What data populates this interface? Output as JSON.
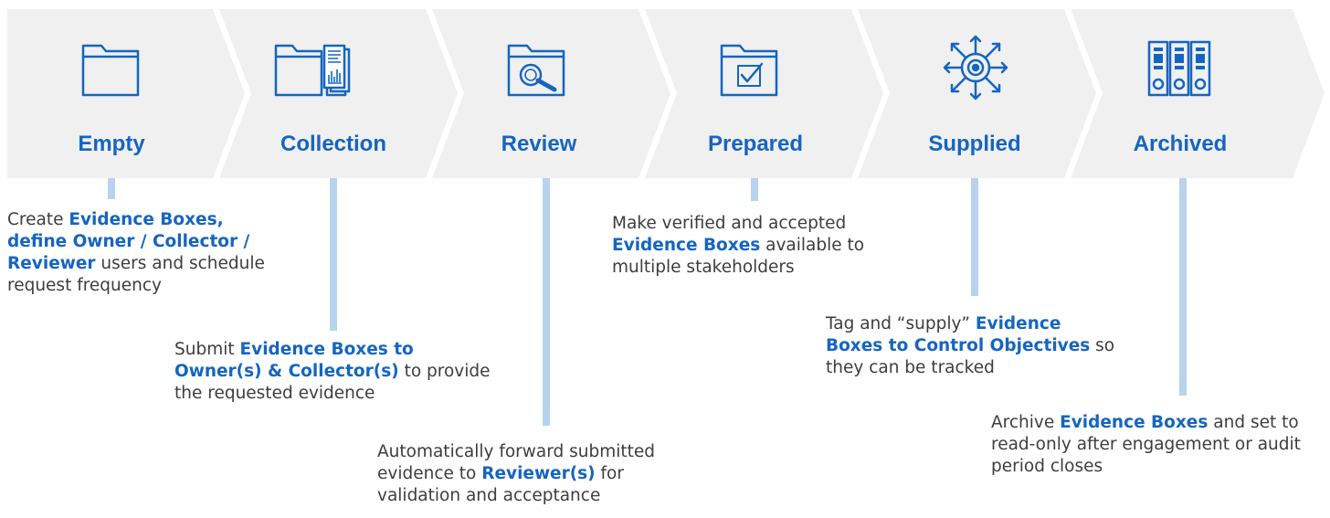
{
  "colors": {
    "accent": "#1565c0",
    "chevron": "#f0f0f0",
    "connector": "#b7d3ee",
    "text": "#3d3d3d"
  },
  "stages": [
    {
      "label": "Empty",
      "icon": "folder-icon"
    },
    {
      "label": "Collection",
      "icon": "folder-documents-icon"
    },
    {
      "label": "Review",
      "icon": "folder-magnifier-icon"
    },
    {
      "label": "Prepared",
      "icon": "folder-checkmark-icon"
    },
    {
      "label": "Supplied",
      "icon": "target-arrows-icon"
    },
    {
      "label": "Archived",
      "icon": "binders-icon"
    }
  ],
  "descriptions": [
    {
      "parts": [
        {
          "t": "Create ",
          "b": false
        },
        {
          "t": "Evidence Boxes, define Owner / Collector / Reviewer",
          "b": true
        },
        {
          "t": " users and schedule request frequency",
          "b": false
        }
      ]
    },
    {
      "parts": [
        {
          "t": "Submit ",
          "b": false
        },
        {
          "t": "Evidence Boxes to Owner(s) & Collector(s)",
          "b": true
        },
        {
          "t": " to provide the requested evidence",
          "b": false
        }
      ]
    },
    {
      "parts": [
        {
          "t": "Automatically forward submitted evidence to ",
          "b": false
        },
        {
          "t": "Reviewer(s)",
          "b": true
        },
        {
          "t": " for validation and acceptance",
          "b": false
        }
      ]
    },
    {
      "parts": [
        {
          "t": "Make verified and accepted ",
          "b": false
        },
        {
          "t": "Evidence Boxes",
          "b": true
        },
        {
          "t": " available to multiple stakeholders",
          "b": false
        }
      ]
    },
    {
      "parts": [
        {
          "t": "Tag and “supply” ",
          "b": false
        },
        {
          "t": "Evidence Boxes to Control Objectives",
          "b": true
        },
        {
          "t": " so they can be tracked",
          "b": false
        }
      ]
    },
    {
      "parts": [
        {
          "t": "Archive ",
          "b": false
        },
        {
          "t": "Evidence Boxes",
          "b": true
        },
        {
          "t": " and set to read-only after engagement or audit period closes",
          "b": false
        }
      ]
    }
  ]
}
